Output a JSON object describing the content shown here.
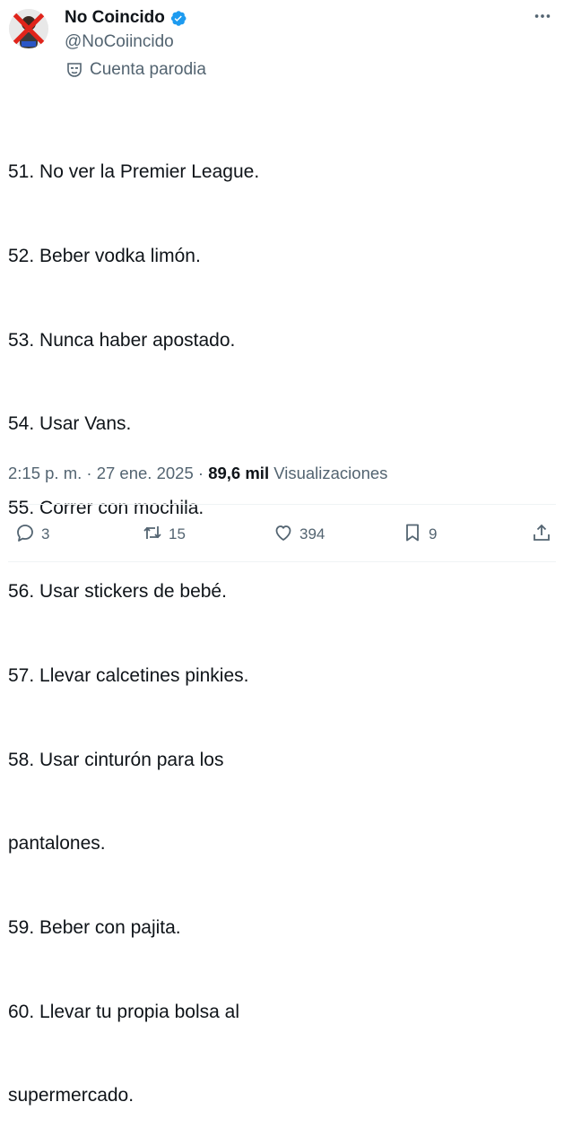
{
  "author": {
    "display_name": "No Coincido",
    "handle": "@NoCoiincido",
    "label": "Cuenta parodia",
    "verified_color": "#1d9bf0"
  },
  "tweet": {
    "lines": [
      "51. No ver la Premier League.",
      "52. Beber vodka limón.",
      "53. Nunca haber apostado.",
      "54. Usar Vans.",
      "55. Correr con mochila.",
      "56. Usar stickers de bebé.",
      "57. Llevar calcetines pinkies.",
      "58. Usar cinturón para los",
      "pantalones.",
      "59. Beber con pajita.",
      "60. Llevar tu propia bolsa al",
      "supermercado."
    ]
  },
  "meta": {
    "time": "2:15 p. m.",
    "sep1": "·",
    "date": "27 ene. 2025",
    "sep2": "·",
    "views_count": "89,6 mil",
    "views_label": "Visualizaciones"
  },
  "actions": {
    "replies": "3",
    "reposts": "15",
    "likes": "394",
    "bookmarks": "9"
  },
  "icons": {
    "avatar": "avatar-crossed-out",
    "verified": "verified-badge-icon",
    "parody": "parody-mask-icon",
    "more": "more-dots-icon",
    "reply": "reply-icon",
    "repost": "repost-icon",
    "like": "heart-icon",
    "bookmark": "bookmark-icon",
    "share": "share-icon"
  }
}
